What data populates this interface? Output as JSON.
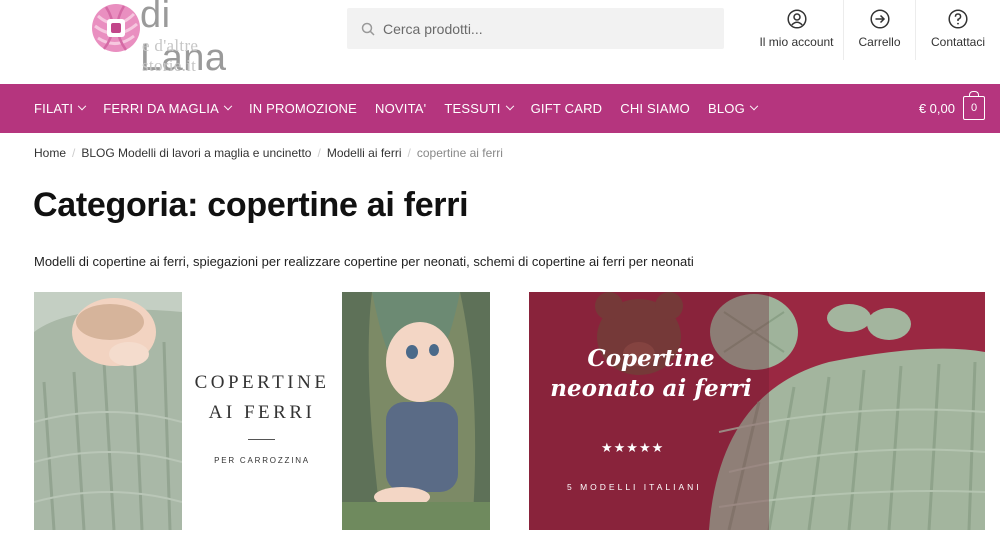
{
  "header": {
    "logo_title": "di Lana",
    "logo_subtitle": "e d'altre storie.it",
    "search_placeholder": "Cerca prodotti...",
    "links": [
      {
        "label": "Il mio account",
        "icon": "user-icon"
      },
      {
        "label": "Carrello",
        "icon": "arrow-right-icon"
      },
      {
        "label": "Contattaci",
        "icon": "question-icon"
      }
    ]
  },
  "nav": {
    "items": [
      {
        "label": "Filati",
        "has_dropdown": true
      },
      {
        "label": "Ferri da maglia",
        "has_dropdown": true
      },
      {
        "label": "In promozione",
        "has_dropdown": false
      },
      {
        "label": "Novita'",
        "has_dropdown": false
      },
      {
        "label": "Tessuti",
        "has_dropdown": true
      },
      {
        "label": "Gift card",
        "has_dropdown": false
      },
      {
        "label": "Chi siamo",
        "has_dropdown": false
      },
      {
        "label": "Blog",
        "has_dropdown": true
      }
    ],
    "cart_total": "€ 0,00",
    "cart_count": "0",
    "background": "#b5357e"
  },
  "breadcrumb": {
    "items": [
      "Home",
      "BLOG Modelli di lavori a maglia e uncinetto",
      "Modelli ai ferri"
    ],
    "current": "copertine ai ferri"
  },
  "page": {
    "title": "Categoria: copertine ai ferri",
    "description": "Modelli di copertine ai ferri, spiegazioni per realizzare copertine per neonati, schemi di copertine ai ferri per neonati"
  },
  "cards": [
    {
      "title_line1": "COPERTINE",
      "title_line2": "AI FERRI",
      "subtitle": "PER CARROZZINA"
    },
    {
      "title_line1": "Copertine",
      "title_line2": "neonato ai ferri",
      "stars": "★★★★★",
      "subtitle": "5 MODELLI ITALIANI",
      "background": "#8a1f38"
    }
  ]
}
